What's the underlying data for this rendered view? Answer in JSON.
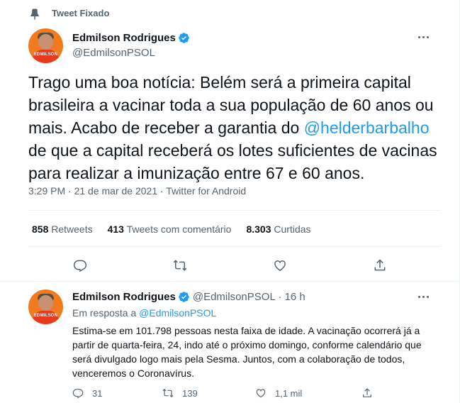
{
  "pinned": {
    "label": "Tweet Fixado",
    "icon": "pin-icon"
  },
  "main_tweet": {
    "avatar_text": "EDMILSON",
    "display_name": "Edmilson Rodrigues",
    "handle": "@EdmilsonPSOL",
    "text_before_mention": "Trago uma boa notícia: Belém será a primeira capital brasileira a vacinar toda a sua população de 60 anos ou mais. Acabo de receber a garantia do ",
    "mention": "@helderbarbalho",
    "text_after_mention": " de que a capital receberá os lotes suficientes de vacinas para realizar a imunização entre 67 e 60 anos.",
    "meta": "3:29 PM · 21 de mar de 2021 · Twitter for Android",
    "stats": {
      "retweets_count": "858",
      "retweets_label": "Retweets",
      "quotes_count": "413",
      "quotes_label": "Tweets com comentário",
      "likes_count": "8.303",
      "likes_label": "Curtidas"
    }
  },
  "reply_tweet": {
    "avatar_text": "EDMILSON",
    "display_name": "Edmilson Rodrigues",
    "handle_time": "@EdmilsonPSOL · 16 h",
    "reply_prefix": "Em resposta a ",
    "reply_mention": "@EdmilsonPSOL",
    "text": "Estima-se em 101.798 pessoas nesta faixa de idade. A vacinação ocorrerá já a partir de quarta-feira, 24, indo até o próximo domingo, conforme calendário que será divulgado logo mais pela Sesma. Juntos, com a colaboração de todos, venceremos o Coronavírus.",
    "replies": "31",
    "retweets": "139",
    "likes": "1,1 mil"
  },
  "colors": {
    "accent": "#1d9bf0",
    "secondary_text": "#536471",
    "primary_text": "#0f1419",
    "divider": "#eff3f4",
    "avatar_orange": "#f07b1e"
  }
}
